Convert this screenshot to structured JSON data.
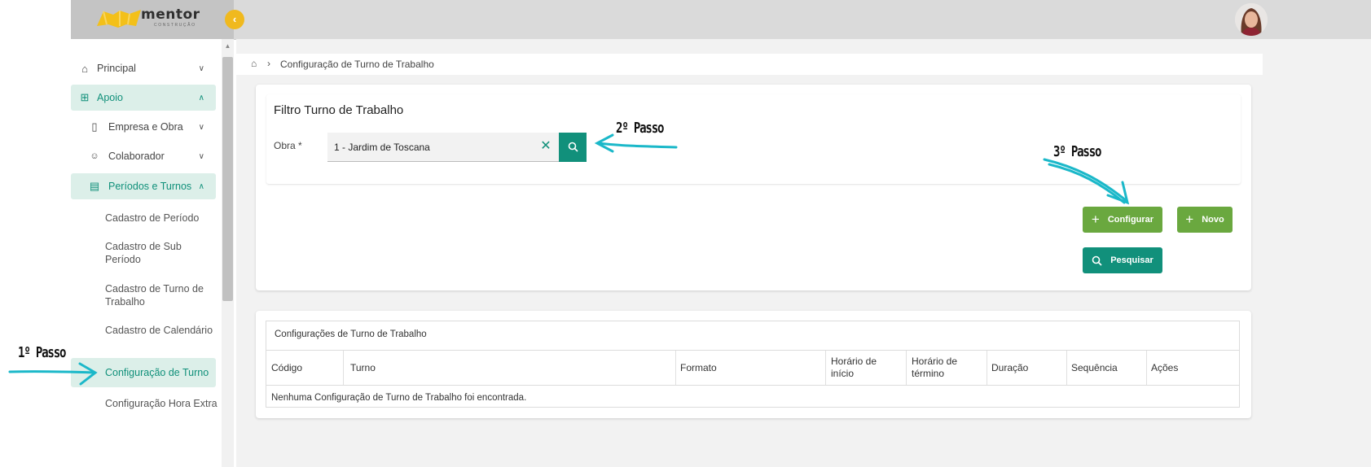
{
  "logo": {
    "name": "mentor",
    "sub": "CONSTRUÇÃO"
  },
  "header": {
    "collapse_icon": "chevron-left-icon"
  },
  "sidebar": {
    "items": [
      {
        "label": "Principal",
        "icon": "home-icon"
      },
      {
        "label": "Apoio",
        "icon": "grid-icon"
      },
      {
        "label": "Empresa e Obra",
        "icon": "building-icon"
      },
      {
        "label": "Colaborador",
        "icon": "users-icon"
      },
      {
        "label": "Períodos e Turnos",
        "icon": "calendar-icon"
      }
    ],
    "sub_items": [
      "Cadastro de Período",
      "Cadastro de Sub Período",
      "Cadastro de Turno de Trabalho",
      "Cadastro de Calendário",
      "Configuração de Turno",
      "Configuração Hora Extra"
    ]
  },
  "breadcrumb": {
    "current": "Configuração de Turno de Trabalho"
  },
  "filter": {
    "title": "Filtro Turno de Trabalho",
    "obra_label": "Obra *",
    "obra_value": "1 - Jardim de Toscana"
  },
  "buttons": {
    "configurar": "Configurar",
    "novo": "Novo",
    "pesquisar": "Pesquisar"
  },
  "table": {
    "title": "Configurações de Turno de Trabalho",
    "columns": [
      "Código",
      "Turno",
      "Formato",
      "Horário de início",
      "Horário de término",
      "Duração",
      "Sequência",
      "Ações"
    ],
    "empty_message": "Nenhuma Configuração de Turno de Trabalho foi encontrada."
  },
  "annotations": {
    "step1": "1º Passo",
    "step2": "2º Passo",
    "step3": "3º Passo"
  },
  "colors": {
    "primary_teal": "#11907b",
    "green": "#6aa83f",
    "accent_yellow": "#f0b91e",
    "arrow": "#1bb8c9"
  }
}
